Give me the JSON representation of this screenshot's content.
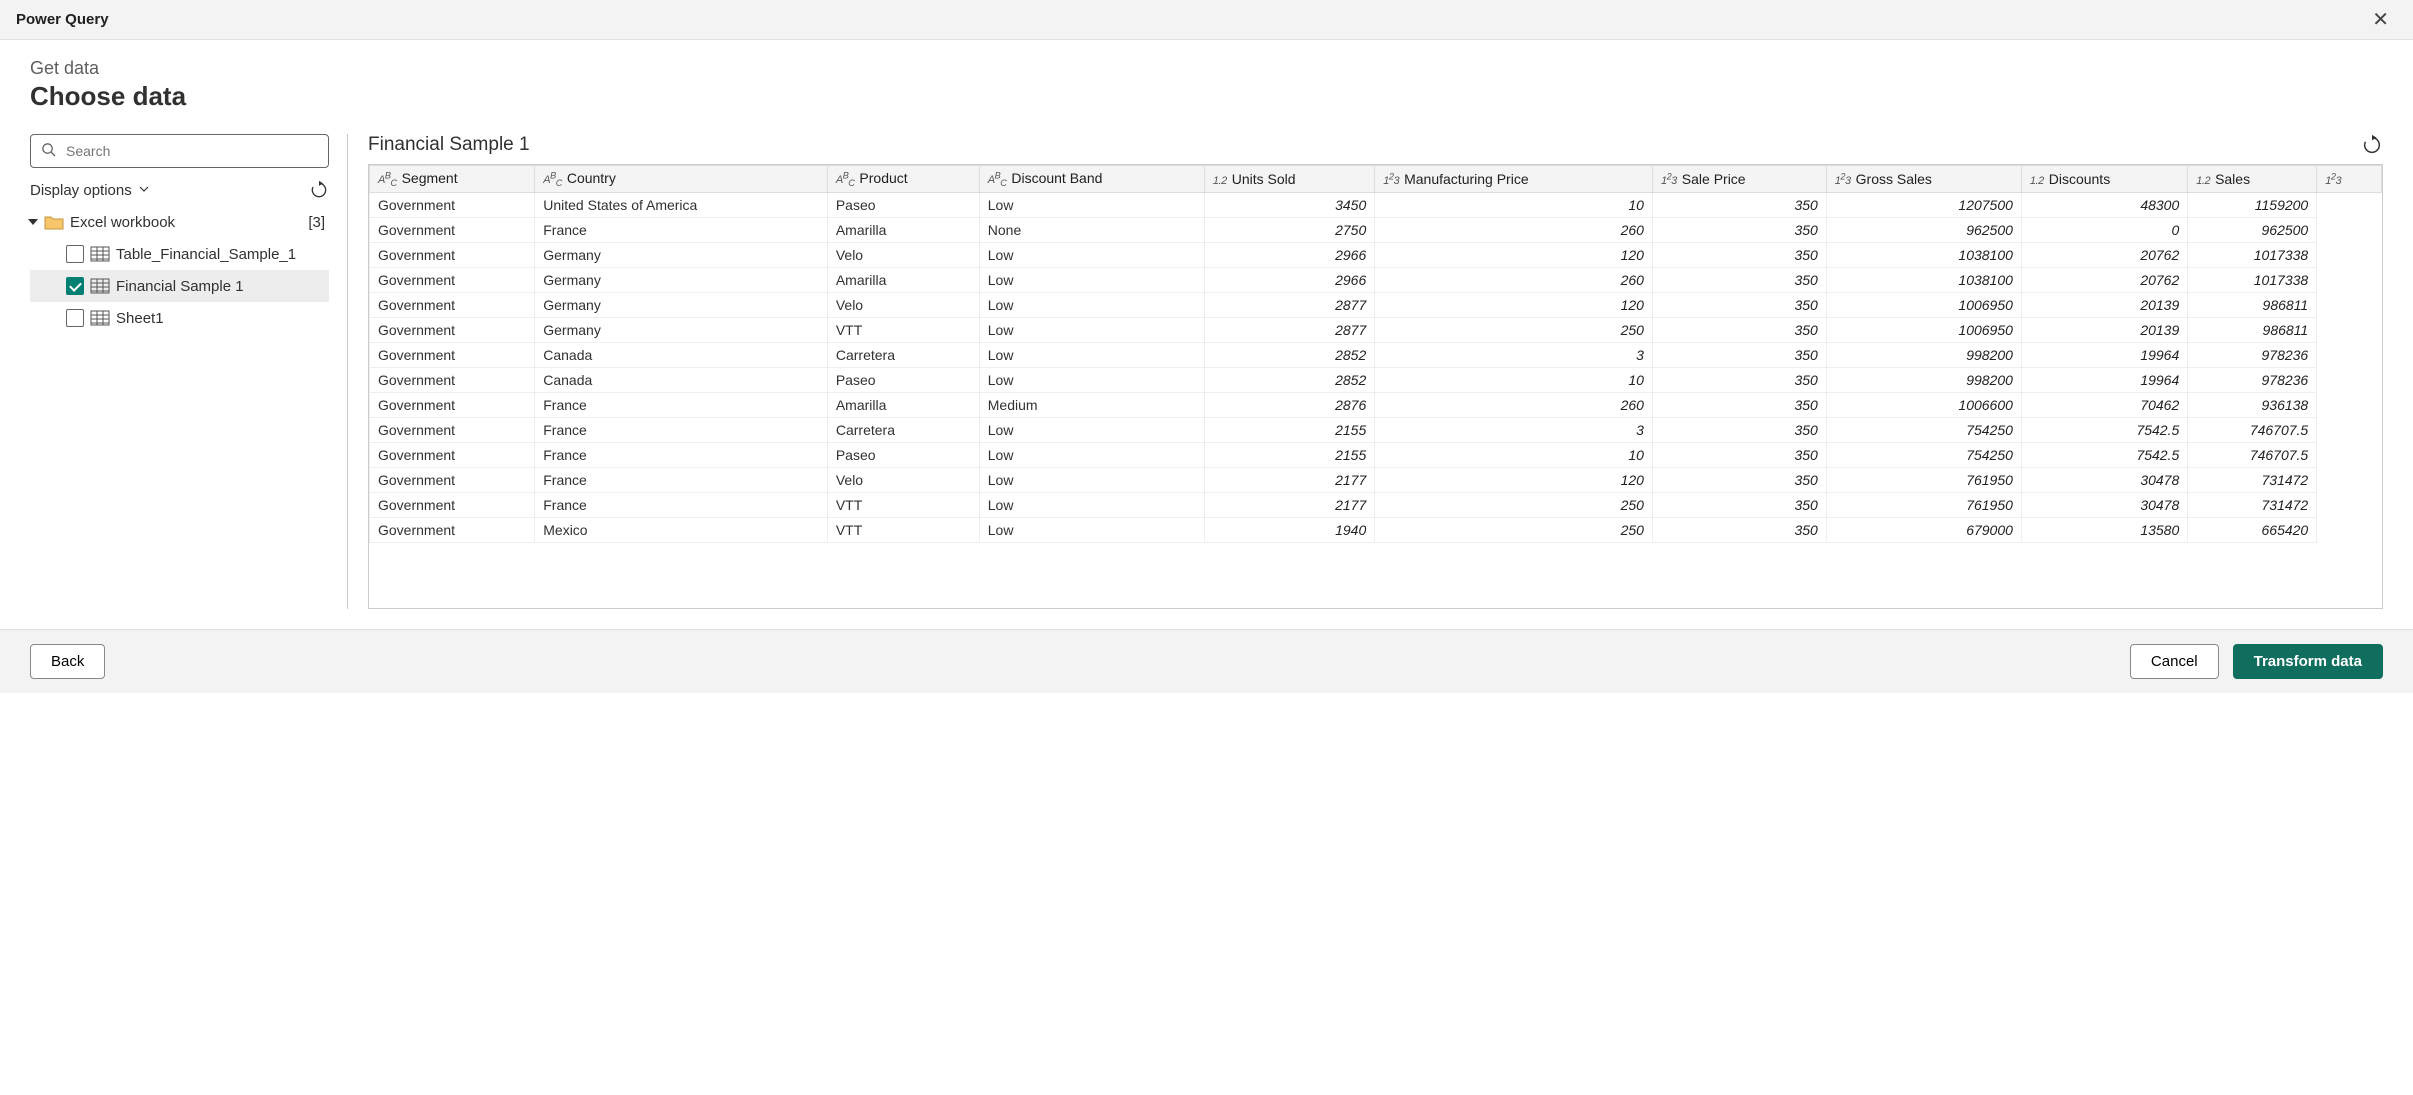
{
  "window": {
    "title": "Power Query"
  },
  "header": {
    "breadcrumb": "Get data",
    "page_title": "Choose data"
  },
  "search": {
    "placeholder": "Search"
  },
  "display_options": {
    "label": "Display options"
  },
  "tree": {
    "root": {
      "label": "Excel workbook",
      "count": "[3]"
    },
    "items": [
      {
        "label": "Table_Financial_Sample_1",
        "checked": false,
        "selected": false
      },
      {
        "label": "Financial Sample 1",
        "checked": true,
        "selected": true
      },
      {
        "label": "Sheet1",
        "checked": false,
        "selected": false
      }
    ]
  },
  "preview": {
    "title": "Financial Sample 1",
    "columns": [
      {
        "type": "ABC",
        "label": "Segment",
        "kind": "txt"
      },
      {
        "type": "ABC",
        "label": "Country",
        "kind": "txt"
      },
      {
        "type": "ABC",
        "label": "Product",
        "kind": "txt"
      },
      {
        "type": "ABC",
        "label": "Discount Band",
        "kind": "txt"
      },
      {
        "type": "1.2",
        "label": "Units Sold",
        "kind": "num"
      },
      {
        "type": "123",
        "label": "Manufacturing Price",
        "kind": "num"
      },
      {
        "type": "123",
        "label": "Sale Price",
        "kind": "num"
      },
      {
        "type": "123",
        "label": "Gross Sales",
        "kind": "num"
      },
      {
        "type": "1.2",
        "label": "Discounts",
        "kind": "num"
      },
      {
        "type": "1.2",
        "label": "Sales",
        "kind": "num"
      },
      {
        "type": "123",
        "label": "",
        "kind": "num"
      }
    ],
    "rows": [
      [
        "Government",
        "United States of America",
        "Paseo",
        "Low",
        "3450",
        "10",
        "350",
        "1207500",
        "48300",
        "1159200"
      ],
      [
        "Government",
        "France",
        "Amarilla",
        "None",
        "2750",
        "260",
        "350",
        "962500",
        "0",
        "962500"
      ],
      [
        "Government",
        "Germany",
        "Velo",
        "Low",
        "2966",
        "120",
        "350",
        "1038100",
        "20762",
        "1017338"
      ],
      [
        "Government",
        "Germany",
        "Amarilla",
        "Low",
        "2966",
        "260",
        "350",
        "1038100",
        "20762",
        "1017338"
      ],
      [
        "Government",
        "Germany",
        "Velo",
        "Low",
        "2877",
        "120",
        "350",
        "1006950",
        "20139",
        "986811"
      ],
      [
        "Government",
        "Germany",
        "VTT",
        "Low",
        "2877",
        "250",
        "350",
        "1006950",
        "20139",
        "986811"
      ],
      [
        "Government",
        "Canada",
        "Carretera",
        "Low",
        "2852",
        "3",
        "350",
        "998200",
        "19964",
        "978236"
      ],
      [
        "Government",
        "Canada",
        "Paseo",
        "Low",
        "2852",
        "10",
        "350",
        "998200",
        "19964",
        "978236"
      ],
      [
        "Government",
        "France",
        "Amarilla",
        "Medium",
        "2876",
        "260",
        "350",
        "1006600",
        "70462",
        "936138"
      ],
      [
        "Government",
        "France",
        "Carretera",
        "Low",
        "2155",
        "3",
        "350",
        "754250",
        "7542.5",
        "746707.5"
      ],
      [
        "Government",
        "France",
        "Paseo",
        "Low",
        "2155",
        "10",
        "350",
        "754250",
        "7542.5",
        "746707.5"
      ],
      [
        "Government",
        "France",
        "Velo",
        "Low",
        "2177",
        "120",
        "350",
        "761950",
        "30478",
        "731472"
      ],
      [
        "Government",
        "France",
        "VTT",
        "Low",
        "2177",
        "250",
        "350",
        "761950",
        "30478",
        "731472"
      ],
      [
        "Government",
        "Mexico",
        "VTT",
        "Low",
        "1940",
        "250",
        "350",
        "679000",
        "13580",
        "665420"
      ]
    ]
  },
  "footer": {
    "back": "Back",
    "cancel": "Cancel",
    "transform": "Transform data"
  }
}
